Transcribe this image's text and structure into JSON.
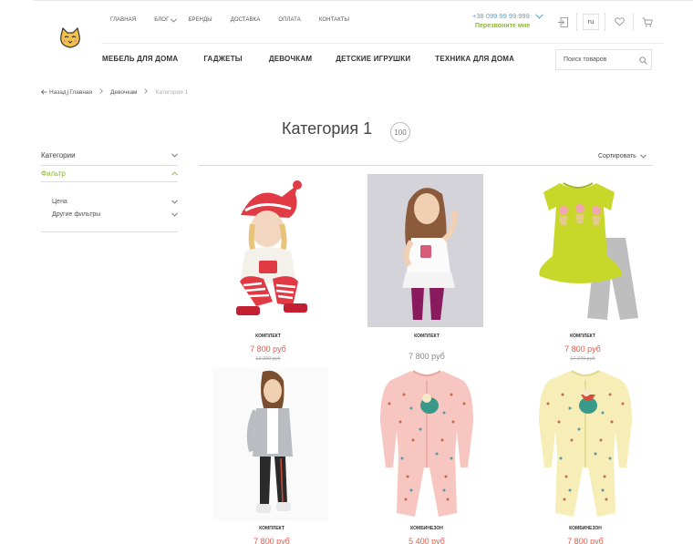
{
  "header": {
    "top_nav": [
      "ГЛАВНАЯ",
      "БЛОГ",
      "БРЕНДЫ",
      "ДОСТАВКА",
      "ОПЛАТА",
      "КОНТАКТЫ"
    ],
    "phone": "+38 099 99 99 999",
    "callback": "Перезвоните мне",
    "lang": "ru",
    "logo_icon": "cat-logo-icon"
  },
  "main_nav": [
    "МЕБЕЛЬ ДЛЯ ДОМА",
    "ГАДЖЕТЫ",
    "ДЕВОЧКАМ",
    "ДЕТСКИЕ ИГРУШКИ",
    "ТЕХНИКА ДЛЯ ДОМА"
  ],
  "search": {
    "placeholder": "Поиск товаров"
  },
  "breadcrumb": {
    "back": "Назад",
    "sep": "|",
    "items": [
      "Главная",
      "Девочкам",
      "Категория 1"
    ]
  },
  "page": {
    "title": "Категория 1",
    "count": "100",
    "sort": "Сортировать"
  },
  "sidebar": {
    "categories": "Категории",
    "filter": "Фильтр",
    "sub": [
      "Цена",
      "Другие фильтры"
    ]
  },
  "products": [
    {
      "title": "КОМПЛЕКТ",
      "price": "7 800 руб",
      "old_price": "13 200 руб"
    },
    {
      "title": "КОМПЛЕКТ",
      "price": "7 800 руб",
      "old_price": ""
    },
    {
      "title": "КОМПЛЕКТ",
      "price": "7 800 руб",
      "old_price": "17 349 руб"
    },
    {
      "title": "КОМПЛЕКТ",
      "price": "7 800 руб",
      "old_price": ""
    },
    {
      "title": "КОМБИНЕЗОН",
      "price": "5 400 руб",
      "old_price": ""
    },
    {
      "title": "КОМБИНЕЗОН",
      "price": "7 800 руб",
      "old_price": ""
    }
  ],
  "colors": {
    "accent_green": "#8bb62d",
    "price_red": "#e8584a",
    "phone_blue": "#5aa0d8"
  }
}
